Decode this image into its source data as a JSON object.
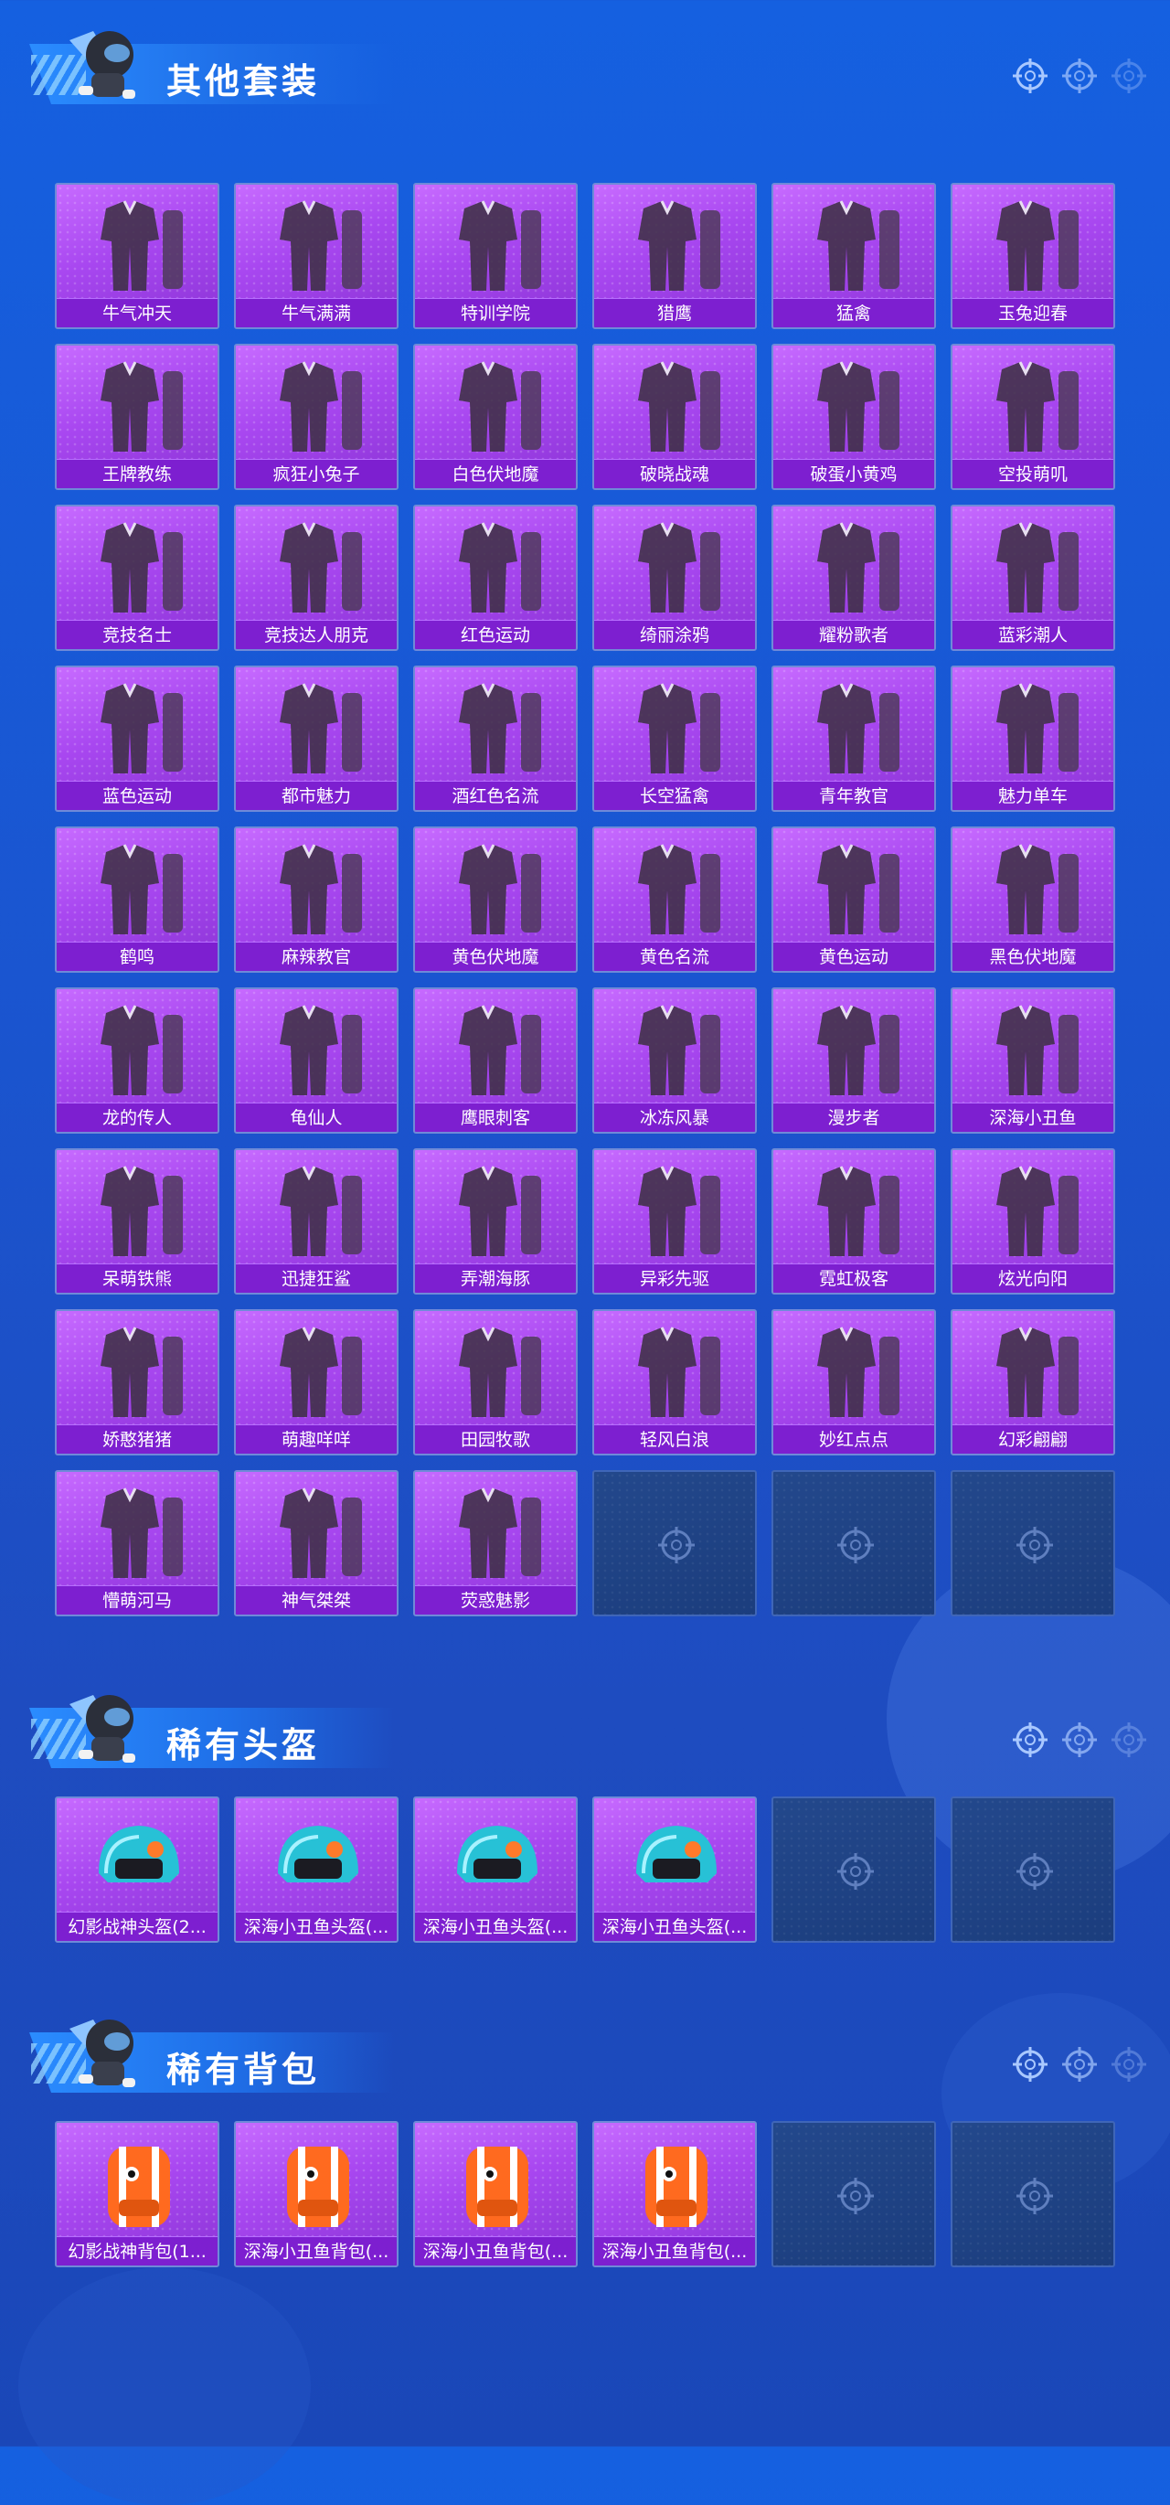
{
  "colors": {
    "background": "#1a55d0",
    "card_purple": "#a847f0",
    "label_bar": "#7d1fd0",
    "empty_card": "#1f4386"
  },
  "sections": [
    {
      "title": "其他套装",
      "items": [
        {
          "name": "牛气冲天",
          "icon": "outfit-icon"
        },
        {
          "name": "牛气满满",
          "icon": "outfit-icon"
        },
        {
          "name": "特训学院",
          "icon": "outfit-icon"
        },
        {
          "name": "猎鹰",
          "icon": "outfit-icon"
        },
        {
          "name": "猛禽",
          "icon": "outfit-icon"
        },
        {
          "name": "玉兔迎春",
          "icon": "outfit-icon"
        },
        {
          "name": "王牌教练",
          "icon": "outfit-icon"
        },
        {
          "name": "疯狂小兔子",
          "icon": "outfit-icon"
        },
        {
          "name": "白色伏地魔",
          "icon": "outfit-icon"
        },
        {
          "name": "破晓战魂",
          "icon": "outfit-icon"
        },
        {
          "name": "破蛋小黄鸡",
          "icon": "outfit-icon"
        },
        {
          "name": "空投萌叽",
          "icon": "outfit-icon"
        },
        {
          "name": "竞技名士",
          "icon": "outfit-icon"
        },
        {
          "name": "竞技达人朋克",
          "icon": "outfit-icon"
        },
        {
          "name": "红色运动",
          "icon": "outfit-icon"
        },
        {
          "name": "绮丽涂鸦",
          "icon": "outfit-icon"
        },
        {
          "name": "耀粉歌者",
          "icon": "outfit-icon"
        },
        {
          "name": "蓝彩潮人",
          "icon": "outfit-icon"
        },
        {
          "name": "蓝色运动",
          "icon": "outfit-icon"
        },
        {
          "name": "都市魅力",
          "icon": "outfit-icon"
        },
        {
          "name": "酒红色名流",
          "icon": "outfit-icon"
        },
        {
          "name": "长空猛禽",
          "icon": "outfit-icon"
        },
        {
          "name": "青年教官",
          "icon": "outfit-icon"
        },
        {
          "name": "魅力单车",
          "icon": "outfit-icon"
        },
        {
          "name": "鹤鸣",
          "icon": "outfit-icon"
        },
        {
          "name": "麻辣教官",
          "icon": "outfit-icon"
        },
        {
          "name": "黄色伏地魔",
          "icon": "outfit-icon"
        },
        {
          "name": "黄色名流",
          "icon": "outfit-icon"
        },
        {
          "name": "黄色运动",
          "icon": "outfit-icon"
        },
        {
          "name": "黑色伏地魔",
          "icon": "outfit-icon"
        },
        {
          "name": "龙的传人",
          "icon": "outfit-icon"
        },
        {
          "name": "龟仙人",
          "icon": "outfit-icon"
        },
        {
          "name": "鹰眼刺客",
          "icon": "outfit-icon"
        },
        {
          "name": "冰冻风暴",
          "icon": "outfit-icon"
        },
        {
          "name": "漫步者",
          "icon": "outfit-icon"
        },
        {
          "name": "深海小丑鱼",
          "icon": "outfit-icon"
        },
        {
          "name": "呆萌铁熊",
          "icon": "outfit-icon"
        },
        {
          "name": "迅捷狂鲨",
          "icon": "outfit-icon"
        },
        {
          "name": "弄潮海豚",
          "icon": "outfit-icon"
        },
        {
          "name": "异彩先驱",
          "icon": "outfit-icon"
        },
        {
          "name": "霓虹极客",
          "icon": "outfit-icon"
        },
        {
          "name": "炫光向阳",
          "icon": "outfit-icon"
        },
        {
          "name": "娇憨猪猪",
          "icon": "outfit-icon"
        },
        {
          "name": "萌趣咩咩",
          "icon": "outfit-icon"
        },
        {
          "name": "田园牧歌",
          "icon": "outfit-icon"
        },
        {
          "name": "轻风白浪",
          "icon": "outfit-icon"
        },
        {
          "name": "妙红点点",
          "icon": "outfit-icon"
        },
        {
          "name": "幻彩翩翩",
          "icon": "outfit-icon"
        },
        {
          "name": "懵萌河马",
          "icon": "outfit-icon"
        },
        {
          "name": "神气桀桀",
          "icon": "outfit-icon"
        },
        {
          "name": "荧惑魅影",
          "icon": "outfit-icon"
        }
      ],
      "empty_slots": 3
    },
    {
      "title": "稀有头盔",
      "items": [
        {
          "name": "幻影战神头盔(2...",
          "icon": "helmet-icon"
        },
        {
          "name": "深海小丑鱼头盔(...",
          "icon": "helmet-icon"
        },
        {
          "name": "深海小丑鱼头盔(...",
          "icon": "helmet-icon"
        },
        {
          "name": "深海小丑鱼头盔(...",
          "icon": "helmet-icon"
        }
      ],
      "empty_slots": 2
    },
    {
      "title": "稀有背包",
      "items": [
        {
          "name": "幻影战神背包(1...",
          "icon": "backpack-icon"
        },
        {
          "name": "深海小丑鱼背包(...",
          "icon": "backpack-icon"
        },
        {
          "name": "深海小丑鱼背包(...",
          "icon": "backpack-icon"
        },
        {
          "name": "深海小丑鱼背包(...",
          "icon": "backpack-icon"
        }
      ],
      "empty_slots": 2
    }
  ]
}
